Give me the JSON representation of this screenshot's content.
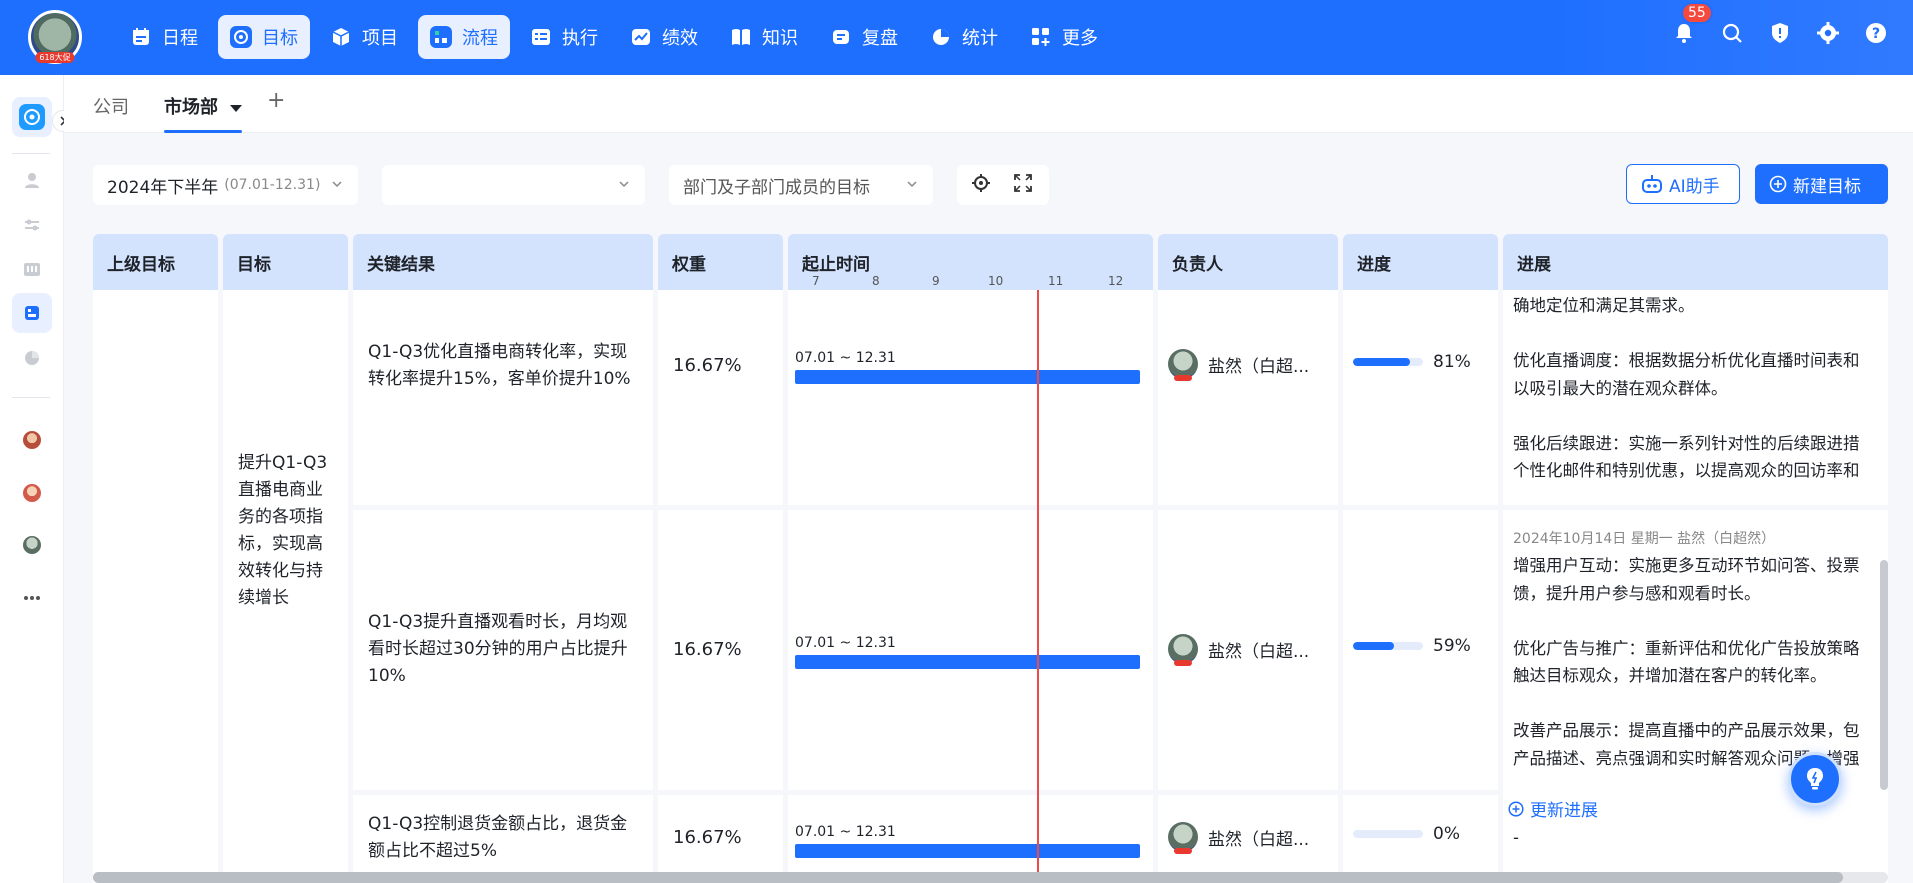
{
  "nav": {
    "avatar_tag": "618大促",
    "items": [
      {
        "label": "日程",
        "icon": "calendar-icon"
      },
      {
        "label": "目标",
        "icon": "target-icon",
        "active": true
      },
      {
        "label": "项目",
        "icon": "cube-icon"
      },
      {
        "label": "流程",
        "icon": "flow-icon",
        "active": true
      },
      {
        "label": "执行",
        "icon": "task-icon"
      },
      {
        "label": "绩效",
        "icon": "performance-icon"
      },
      {
        "label": "知识",
        "icon": "book-icon"
      },
      {
        "label": "复盘",
        "icon": "review-icon"
      },
      {
        "label": "统计",
        "icon": "pie-icon"
      },
      {
        "label": "更多",
        "icon": "grid-plus-icon"
      }
    ],
    "notification_count": "55"
  },
  "tabs": {
    "company": "公司",
    "marketing": "市场部",
    "add": "+"
  },
  "filters": {
    "period": "2024年下半年",
    "period_range": "(07.01-12.31)",
    "empty_select": "",
    "scope": "部门及子部门成员的目标"
  },
  "actions": {
    "ai_assistant": "AI助手",
    "new_goal": "新建目标"
  },
  "table": {
    "headers": {
      "parent_goal": "上级目标",
      "goal": "目标",
      "key_results": "关键结果",
      "weight": "权重",
      "timeline": "起止时间",
      "owner": "负责人",
      "progress": "进度",
      "updates": "进展"
    },
    "months": [
      "7",
      "8",
      "9",
      "10",
      "11",
      "12"
    ],
    "goal_text": "提升Q1-Q3直播电商业务的各项指标，实现高效转化与持续增长",
    "rows": [
      {
        "kr": "Q1-Q3优化直播电商转化率，实现转化率提升15%，客单价提升10%",
        "weight": "16.67%",
        "date_range": "07.01 ~ 12.31",
        "owner": "盐然（白超...",
        "progress_label": "81%",
        "progress_value": 0.81,
        "update": "确地定位和满足其需求。\n\n优化直播调度：根据数据分析优化直播时间表和\n以吸引最大的潜在观众群体。\n\n强化后续跟进：实施一系列针对性的后续跟进措\n个性化邮件和特别优惠，以提高观众的回访率和"
      },
      {
        "kr": "Q1-Q3提升直播观看时长，月均观看时长超过30分钟的用户占比提升10%",
        "weight": "16.67%",
        "date_range": "07.01 ~ 12.31",
        "owner": "盐然（白超...",
        "progress_label": "59%",
        "progress_value": 0.59,
        "update_meta": "2024年10月14日  星期一  盐然（白超然）",
        "update": "增强用户互动：实施更多互动环节如问答、投票\n馈，提升用户参与感和观看时长。\n\n优化广告与推广：重新评估和优化广告投放策略\n触达目标观众，并增加潜在客户的转化率。\n\n改善产品展示：提高直播中的产品展示效果，包\n产品描述、亮点强调和实时解答观众问题，增强",
        "update_link": "更新进展"
      },
      {
        "kr": "Q1-Q3控制退货金额占比，退货金额占比不超过5%",
        "weight": "16.67%",
        "date_range": "07.01 ~ 12.31",
        "owner": "盐然（白超...",
        "progress_label": "0%",
        "progress_value": 0,
        "update": "-"
      }
    ]
  },
  "colors": {
    "brand": "#1f6fff",
    "header_bg": "#d3e3fd",
    "today_line": "#ee4a4a"
  }
}
